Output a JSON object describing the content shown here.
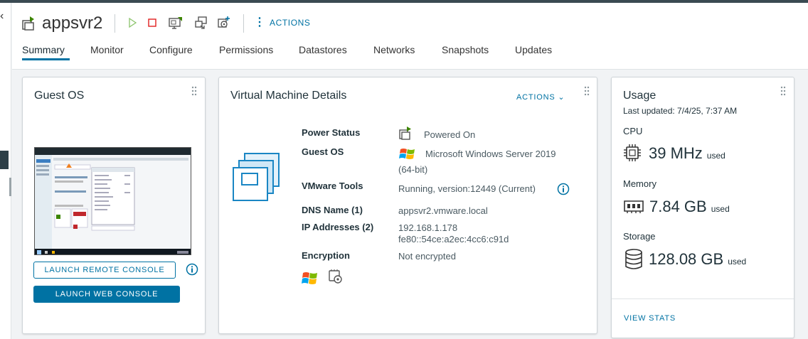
{
  "header": {
    "title": "appsvr2",
    "actions_label": "ACTIONS"
  },
  "toolbar_icons": [
    "power-on-icon",
    "power-off-icon",
    "launch-console-icon",
    "migrate-icon",
    "settings-icon"
  ],
  "tabs": [
    {
      "label": "Summary",
      "active": true
    },
    {
      "label": "Monitor"
    },
    {
      "label": "Configure"
    },
    {
      "label": "Permissions"
    },
    {
      "label": "Datastores"
    },
    {
      "label": "Networks"
    },
    {
      "label": "Snapshots"
    },
    {
      "label": "Updates"
    }
  ],
  "guest_os": {
    "title": "Guest OS",
    "launch_remote_label": "LAUNCH REMOTE CONSOLE",
    "launch_web_label": "LAUNCH WEB CONSOLE"
  },
  "vm_details": {
    "title": "Virtual Machine Details",
    "actions_label": "ACTIONS",
    "power_status_label": "Power Status",
    "power_status_value": "Powered On",
    "guest_os_label": "Guest OS",
    "guest_os_value_line1": "Microsoft Windows Server 2019",
    "guest_os_value_line2": "(64-bit)",
    "vmware_tools_label": "VMware Tools",
    "vmware_tools_value": "Running, version:12449 (Current)",
    "dns_label": "DNS Name (1)",
    "dns_value": "appsvr2.vmware.local",
    "ip_label": "IP Addresses (2)",
    "ip_value_1": "192.168.1.178",
    "ip_value_2": "fe80::54ce:a2ec:4cc6:c91d",
    "encryption_label": "Encryption",
    "encryption_value": "Not encrypted"
  },
  "usage": {
    "title": "Usage",
    "last_updated": "Last updated: 7/4/25, 7:37 AM",
    "cpu_label": "CPU",
    "cpu_value": "39 MHz",
    "memory_label": "Memory",
    "memory_value": "7.84 GB",
    "storage_label": "Storage",
    "storage_value": "128.08 GB",
    "unit_label": "used",
    "view_stats_label": "VIEW STATS"
  },
  "colors": {
    "accent": "#0072a3",
    "power_on": "#3c8500",
    "power_off": "#e02020"
  }
}
